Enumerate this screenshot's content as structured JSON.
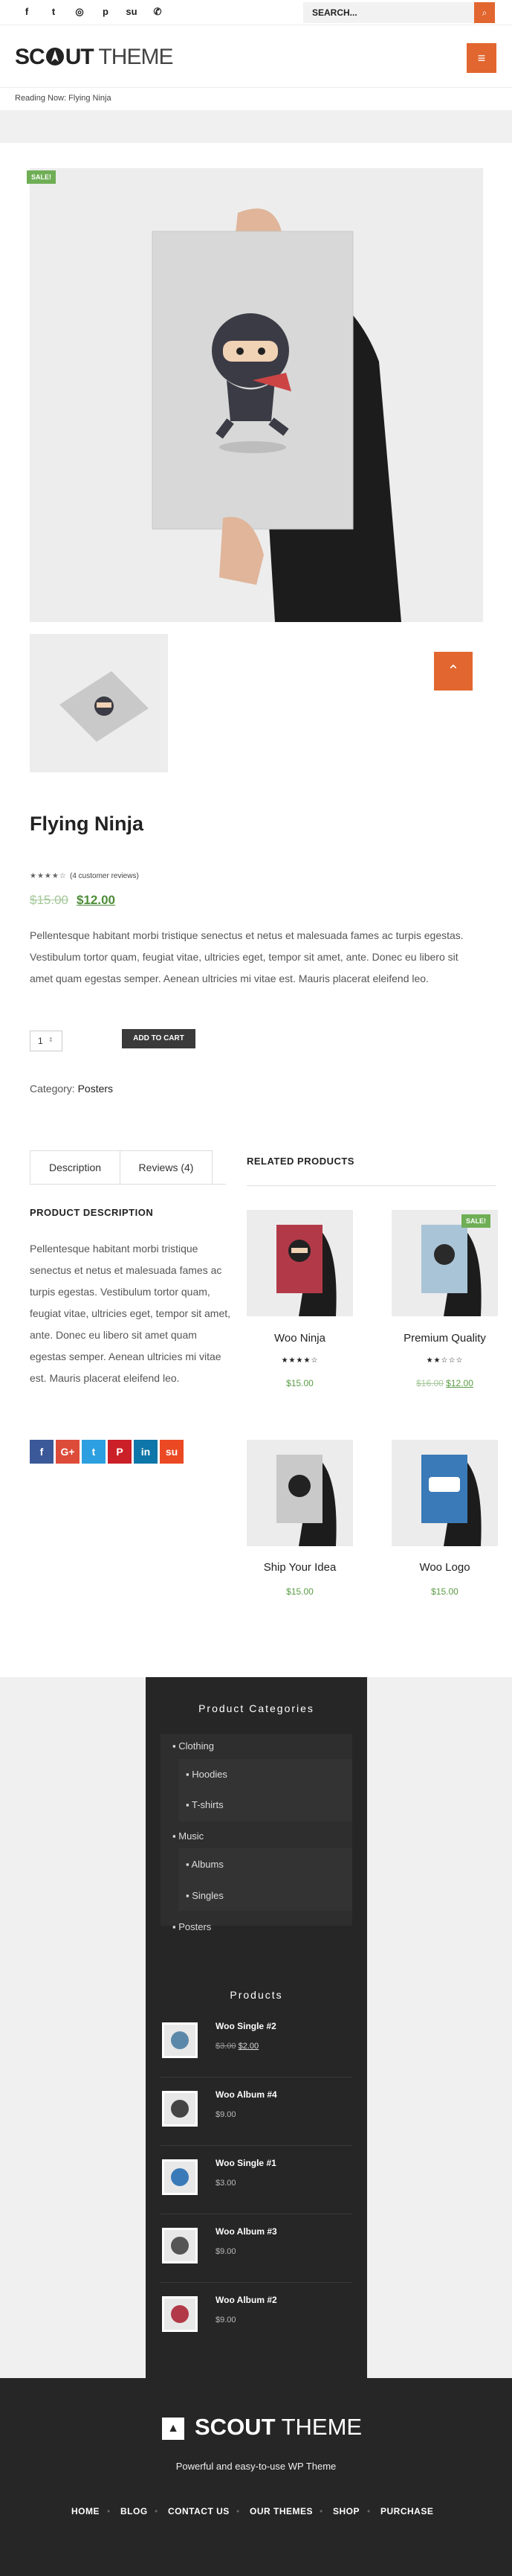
{
  "topbar": {
    "social_icons": [
      "facebook-icon",
      "twitter-icon",
      "instagram-icon",
      "pinterest-icon",
      "stumbleupon-icon",
      "whatsapp-icon"
    ],
    "social_glyphs": [
      "f",
      "t",
      "◎",
      "p",
      "su",
      "✆"
    ],
    "search_placeholder": "SEARCH...",
    "search_button": "⌕"
  },
  "header": {
    "logo_bold": "SC",
    "logo_bold2": "UT",
    "logo_light": "THEME",
    "menu_icon": "≡",
    "reading_now": "Reading Now: Flying Ninja"
  },
  "product": {
    "sale_badge": "SALE!",
    "title": "Flying Ninja",
    "stars": "★★★★☆",
    "rating": 4,
    "reviews_text": "(4 customer reviews)",
    "old_price": "$15.00",
    "new_price": "$12.00",
    "description": "Pellentesque habitant morbi tristique senectus et netus et malesuada fames ac turpis egestas. Vestibulum tortor quam, feugiat vitae, ultricies eget, tempor sit amet, ante. Donec eu libero sit amet quam egestas semper. Aenean ultricies mi vitae est. Mauris placerat eleifend leo.",
    "quantity": "1",
    "add_to_cart": "ADD TO CART",
    "category_label": "Category:",
    "category_value": "Posters",
    "back_to_top": "⌃"
  },
  "tabs": {
    "description": "Description",
    "reviews": "Reviews (4)",
    "panel_heading": "PRODUCT DESCRIPTION",
    "panel_text": "Pellentesque habitant morbi tristique senectus et netus et malesuada fames ac turpis egestas. Vestibulum tortor quam, feugiat vitae, ultricies eget, tempor sit amet, ante. Donec eu libero sit amet quam egestas semper. Aenean ultricies mi vitae est. Mauris placerat eleifend leo."
  },
  "share": [
    {
      "icon": "facebook-icon",
      "glyph": "f",
      "color": "#3b5998"
    },
    {
      "icon": "google-plus-icon",
      "glyph": "G+",
      "color": "#dd4b39"
    },
    {
      "icon": "twitter-icon",
      "glyph": "t",
      "color": "#2b9fe0"
    },
    {
      "icon": "pinterest-icon",
      "glyph": "P",
      "color": "#cb2027"
    },
    {
      "icon": "linkedin-icon",
      "glyph": "in",
      "color": "#0e76a8"
    },
    {
      "icon": "stumbleupon-icon",
      "glyph": "su",
      "color": "#eb4924"
    }
  ],
  "related": {
    "heading": "RELATED PRODUCTS",
    "sale_badge": "SALE!",
    "items": [
      {
        "name": "Woo Ninja",
        "stars": "★★★★☆",
        "rating": 4,
        "price": "$15.00",
        "old_price": "",
        "poster_color": "#b23a48"
      },
      {
        "name": "Premium Quality",
        "stars": "★★☆☆☆",
        "rating": 2,
        "price": "$12.00",
        "old_price": "$16.00",
        "poster_color": "#a9c4d6"
      },
      {
        "name": "Ship Your Idea",
        "stars": "",
        "rating": 0,
        "price": "$15.00",
        "old_price": "",
        "poster_color": "#c9c9c9"
      },
      {
        "name": "Woo Logo",
        "stars": "",
        "rating": 0,
        "price": "$15.00",
        "old_price": "",
        "poster_color": "#3a7ab8"
      }
    ]
  },
  "widgets": {
    "categories_title": "Product Categories",
    "categories": {
      "clothing": "Clothing",
      "hoodies": "Hoodies",
      "tshirts": "T-shirts",
      "music": "Music",
      "albums": "Albums",
      "singles": "Singles",
      "posters": "Posters"
    },
    "products_title": "Products",
    "products": [
      {
        "name": "Woo Single #2",
        "price": "$2.00",
        "old_price": "$3.00"
      },
      {
        "name": "Woo Album #4",
        "price": "$9.00",
        "old_price": ""
      },
      {
        "name": "Woo Single #1",
        "price": "$3.00",
        "old_price": ""
      },
      {
        "name": "Woo Album #3",
        "price": "$9.00",
        "old_price": ""
      },
      {
        "name": "Woo Album #2",
        "price": "$9.00",
        "old_price": ""
      }
    ]
  },
  "footer": {
    "logo_bold": "SCOUT",
    "logo_light": "THEME",
    "tagline": "Powerful and easy-to-use WP Theme",
    "nav": [
      "HOME",
      "BLOG",
      "CONTACT US",
      "OUR THEMES",
      "SHOP",
      "PURCHASE"
    ]
  }
}
